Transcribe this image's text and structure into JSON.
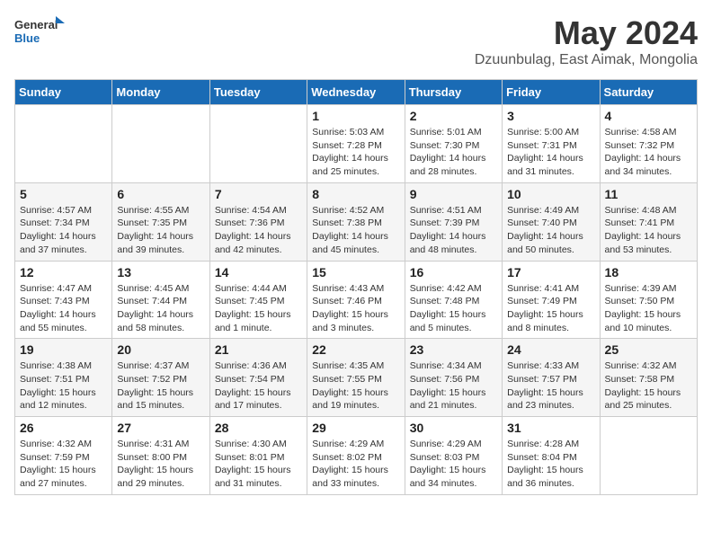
{
  "header": {
    "logo_line1": "General",
    "logo_line2": "Blue",
    "month_title": "May 2024",
    "location": "Dzuunbulag, East Aimak, Mongolia"
  },
  "days_of_week": [
    "Sunday",
    "Monday",
    "Tuesday",
    "Wednesday",
    "Thursday",
    "Friday",
    "Saturday"
  ],
  "weeks": [
    [
      {
        "day": "",
        "info": ""
      },
      {
        "day": "",
        "info": ""
      },
      {
        "day": "",
        "info": ""
      },
      {
        "day": "1",
        "info": "Sunrise: 5:03 AM\nSunset: 7:28 PM\nDaylight: 14 hours\nand 25 minutes."
      },
      {
        "day": "2",
        "info": "Sunrise: 5:01 AM\nSunset: 7:30 PM\nDaylight: 14 hours\nand 28 minutes."
      },
      {
        "day": "3",
        "info": "Sunrise: 5:00 AM\nSunset: 7:31 PM\nDaylight: 14 hours\nand 31 minutes."
      },
      {
        "day": "4",
        "info": "Sunrise: 4:58 AM\nSunset: 7:32 PM\nDaylight: 14 hours\nand 34 minutes."
      }
    ],
    [
      {
        "day": "5",
        "info": "Sunrise: 4:57 AM\nSunset: 7:34 PM\nDaylight: 14 hours\nand 37 minutes."
      },
      {
        "day": "6",
        "info": "Sunrise: 4:55 AM\nSunset: 7:35 PM\nDaylight: 14 hours\nand 39 minutes."
      },
      {
        "day": "7",
        "info": "Sunrise: 4:54 AM\nSunset: 7:36 PM\nDaylight: 14 hours\nand 42 minutes."
      },
      {
        "day": "8",
        "info": "Sunrise: 4:52 AM\nSunset: 7:38 PM\nDaylight: 14 hours\nand 45 minutes."
      },
      {
        "day": "9",
        "info": "Sunrise: 4:51 AM\nSunset: 7:39 PM\nDaylight: 14 hours\nand 48 minutes."
      },
      {
        "day": "10",
        "info": "Sunrise: 4:49 AM\nSunset: 7:40 PM\nDaylight: 14 hours\nand 50 minutes."
      },
      {
        "day": "11",
        "info": "Sunrise: 4:48 AM\nSunset: 7:41 PM\nDaylight: 14 hours\nand 53 minutes."
      }
    ],
    [
      {
        "day": "12",
        "info": "Sunrise: 4:47 AM\nSunset: 7:43 PM\nDaylight: 14 hours\nand 55 minutes."
      },
      {
        "day": "13",
        "info": "Sunrise: 4:45 AM\nSunset: 7:44 PM\nDaylight: 14 hours\nand 58 minutes."
      },
      {
        "day": "14",
        "info": "Sunrise: 4:44 AM\nSunset: 7:45 PM\nDaylight: 15 hours\nand 1 minute."
      },
      {
        "day": "15",
        "info": "Sunrise: 4:43 AM\nSunset: 7:46 PM\nDaylight: 15 hours\nand 3 minutes."
      },
      {
        "day": "16",
        "info": "Sunrise: 4:42 AM\nSunset: 7:48 PM\nDaylight: 15 hours\nand 5 minutes."
      },
      {
        "day": "17",
        "info": "Sunrise: 4:41 AM\nSunset: 7:49 PM\nDaylight: 15 hours\nand 8 minutes."
      },
      {
        "day": "18",
        "info": "Sunrise: 4:39 AM\nSunset: 7:50 PM\nDaylight: 15 hours\nand 10 minutes."
      }
    ],
    [
      {
        "day": "19",
        "info": "Sunrise: 4:38 AM\nSunset: 7:51 PM\nDaylight: 15 hours\nand 12 minutes."
      },
      {
        "day": "20",
        "info": "Sunrise: 4:37 AM\nSunset: 7:52 PM\nDaylight: 15 hours\nand 15 minutes."
      },
      {
        "day": "21",
        "info": "Sunrise: 4:36 AM\nSunset: 7:54 PM\nDaylight: 15 hours\nand 17 minutes."
      },
      {
        "day": "22",
        "info": "Sunrise: 4:35 AM\nSunset: 7:55 PM\nDaylight: 15 hours\nand 19 minutes."
      },
      {
        "day": "23",
        "info": "Sunrise: 4:34 AM\nSunset: 7:56 PM\nDaylight: 15 hours\nand 21 minutes."
      },
      {
        "day": "24",
        "info": "Sunrise: 4:33 AM\nSunset: 7:57 PM\nDaylight: 15 hours\nand 23 minutes."
      },
      {
        "day": "25",
        "info": "Sunrise: 4:32 AM\nSunset: 7:58 PM\nDaylight: 15 hours\nand 25 minutes."
      }
    ],
    [
      {
        "day": "26",
        "info": "Sunrise: 4:32 AM\nSunset: 7:59 PM\nDaylight: 15 hours\nand 27 minutes."
      },
      {
        "day": "27",
        "info": "Sunrise: 4:31 AM\nSunset: 8:00 PM\nDaylight: 15 hours\nand 29 minutes."
      },
      {
        "day": "28",
        "info": "Sunrise: 4:30 AM\nSunset: 8:01 PM\nDaylight: 15 hours\nand 31 minutes."
      },
      {
        "day": "29",
        "info": "Sunrise: 4:29 AM\nSunset: 8:02 PM\nDaylight: 15 hours\nand 33 minutes."
      },
      {
        "day": "30",
        "info": "Sunrise: 4:29 AM\nSunset: 8:03 PM\nDaylight: 15 hours\nand 34 minutes."
      },
      {
        "day": "31",
        "info": "Sunrise: 4:28 AM\nSunset: 8:04 PM\nDaylight: 15 hours\nand 36 minutes."
      },
      {
        "day": "",
        "info": ""
      }
    ]
  ]
}
